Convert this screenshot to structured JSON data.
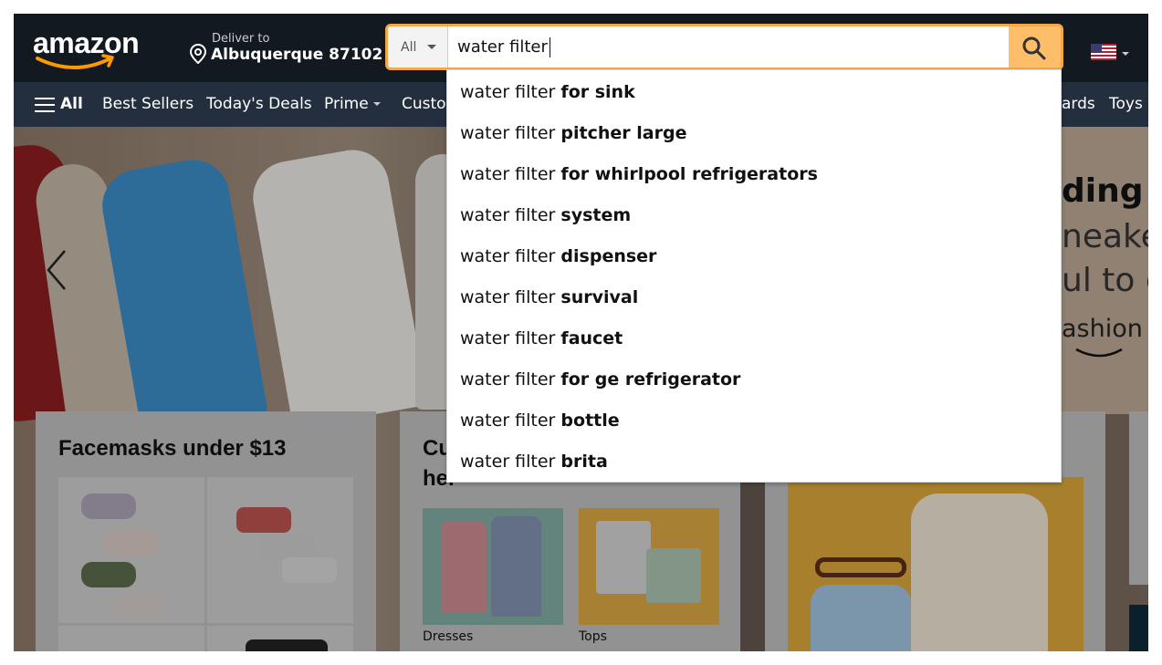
{
  "header": {
    "logo_text": "amazon",
    "deliver": {
      "line1": "Deliver to",
      "line2": "Albuquerque 87102"
    },
    "search": {
      "category": "All",
      "query": "water filter"
    },
    "flag": "us-flag-icon"
  },
  "nav": {
    "all_label": "All",
    "items": [
      {
        "label": "Best Sellers"
      },
      {
        "label": "Today's Deals"
      },
      {
        "label": "Prime"
      },
      {
        "label": "Custor"
      },
      {
        "label": "ards"
      },
      {
        "label": "Toys &"
      }
    ]
  },
  "suggestions": [
    {
      "prefix": "water filter",
      "suffix": "for sink"
    },
    {
      "prefix": "water filter",
      "suffix": "pitcher large"
    },
    {
      "prefix": "water filter",
      "suffix": "for whirlpool refrigerators"
    },
    {
      "prefix": "water filter",
      "suffix": "system"
    },
    {
      "prefix": "water filter",
      "suffix": "dispenser"
    },
    {
      "prefix": "water filter",
      "suffix": "survival"
    },
    {
      "prefix": "water filter",
      "suffix": "faucet"
    },
    {
      "prefix": "water filter",
      "suffix": "for ge refrigerator"
    },
    {
      "prefix": "water filter",
      "suffix": "bottle"
    },
    {
      "prefix": "water filter",
      "suffix": "brita"
    }
  ],
  "hero": {
    "right_text": [
      "ding",
      "neaker",
      "ul to c",
      "ashion"
    ]
  },
  "cards": [
    {
      "title": "Facemasks under $13"
    },
    {
      "title_line1": "Cu",
      "title_line2": "her",
      "thumbs": [
        {
          "caption": "Dresses"
        },
        {
          "caption": "Tops"
        }
      ]
    }
  ],
  "colors": {
    "header_bg": "#131921",
    "nav_bg": "#232f3e",
    "search_accent": "#febd69",
    "search_border": "#f3a847",
    "logo_smile": "#ff9900"
  }
}
